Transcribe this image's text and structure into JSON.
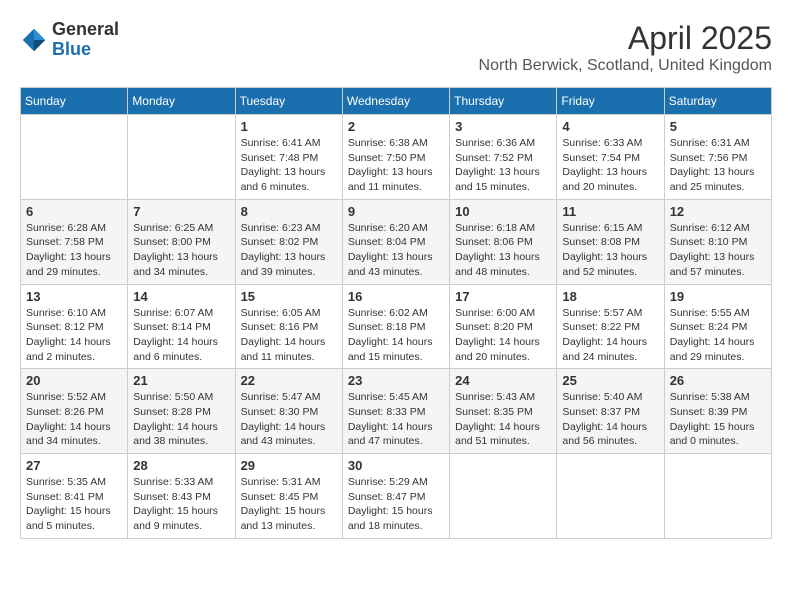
{
  "logo": {
    "general": "General",
    "blue": "Blue"
  },
  "title": "April 2025",
  "location": "North Berwick, Scotland, United Kingdom",
  "weekdays": [
    "Sunday",
    "Monday",
    "Tuesday",
    "Wednesday",
    "Thursday",
    "Friday",
    "Saturday"
  ],
  "weeks": [
    [
      {
        "day": "",
        "info": ""
      },
      {
        "day": "",
        "info": ""
      },
      {
        "day": "1",
        "info": "Sunrise: 6:41 AM\nSunset: 7:48 PM\nDaylight: 13 hours and 6 minutes."
      },
      {
        "day": "2",
        "info": "Sunrise: 6:38 AM\nSunset: 7:50 PM\nDaylight: 13 hours and 11 minutes."
      },
      {
        "day": "3",
        "info": "Sunrise: 6:36 AM\nSunset: 7:52 PM\nDaylight: 13 hours and 15 minutes."
      },
      {
        "day": "4",
        "info": "Sunrise: 6:33 AM\nSunset: 7:54 PM\nDaylight: 13 hours and 20 minutes."
      },
      {
        "day": "5",
        "info": "Sunrise: 6:31 AM\nSunset: 7:56 PM\nDaylight: 13 hours and 25 minutes."
      }
    ],
    [
      {
        "day": "6",
        "info": "Sunrise: 6:28 AM\nSunset: 7:58 PM\nDaylight: 13 hours and 29 minutes."
      },
      {
        "day": "7",
        "info": "Sunrise: 6:25 AM\nSunset: 8:00 PM\nDaylight: 13 hours and 34 minutes."
      },
      {
        "day": "8",
        "info": "Sunrise: 6:23 AM\nSunset: 8:02 PM\nDaylight: 13 hours and 39 minutes."
      },
      {
        "day": "9",
        "info": "Sunrise: 6:20 AM\nSunset: 8:04 PM\nDaylight: 13 hours and 43 minutes."
      },
      {
        "day": "10",
        "info": "Sunrise: 6:18 AM\nSunset: 8:06 PM\nDaylight: 13 hours and 48 minutes."
      },
      {
        "day": "11",
        "info": "Sunrise: 6:15 AM\nSunset: 8:08 PM\nDaylight: 13 hours and 52 minutes."
      },
      {
        "day": "12",
        "info": "Sunrise: 6:12 AM\nSunset: 8:10 PM\nDaylight: 13 hours and 57 minutes."
      }
    ],
    [
      {
        "day": "13",
        "info": "Sunrise: 6:10 AM\nSunset: 8:12 PM\nDaylight: 14 hours and 2 minutes."
      },
      {
        "day": "14",
        "info": "Sunrise: 6:07 AM\nSunset: 8:14 PM\nDaylight: 14 hours and 6 minutes."
      },
      {
        "day": "15",
        "info": "Sunrise: 6:05 AM\nSunset: 8:16 PM\nDaylight: 14 hours and 11 minutes."
      },
      {
        "day": "16",
        "info": "Sunrise: 6:02 AM\nSunset: 8:18 PM\nDaylight: 14 hours and 15 minutes."
      },
      {
        "day": "17",
        "info": "Sunrise: 6:00 AM\nSunset: 8:20 PM\nDaylight: 14 hours and 20 minutes."
      },
      {
        "day": "18",
        "info": "Sunrise: 5:57 AM\nSunset: 8:22 PM\nDaylight: 14 hours and 24 minutes."
      },
      {
        "day": "19",
        "info": "Sunrise: 5:55 AM\nSunset: 8:24 PM\nDaylight: 14 hours and 29 minutes."
      }
    ],
    [
      {
        "day": "20",
        "info": "Sunrise: 5:52 AM\nSunset: 8:26 PM\nDaylight: 14 hours and 34 minutes."
      },
      {
        "day": "21",
        "info": "Sunrise: 5:50 AM\nSunset: 8:28 PM\nDaylight: 14 hours and 38 minutes."
      },
      {
        "day": "22",
        "info": "Sunrise: 5:47 AM\nSunset: 8:30 PM\nDaylight: 14 hours and 43 minutes."
      },
      {
        "day": "23",
        "info": "Sunrise: 5:45 AM\nSunset: 8:33 PM\nDaylight: 14 hours and 47 minutes."
      },
      {
        "day": "24",
        "info": "Sunrise: 5:43 AM\nSunset: 8:35 PM\nDaylight: 14 hours and 51 minutes."
      },
      {
        "day": "25",
        "info": "Sunrise: 5:40 AM\nSunset: 8:37 PM\nDaylight: 14 hours and 56 minutes."
      },
      {
        "day": "26",
        "info": "Sunrise: 5:38 AM\nSunset: 8:39 PM\nDaylight: 15 hours and 0 minutes."
      }
    ],
    [
      {
        "day": "27",
        "info": "Sunrise: 5:35 AM\nSunset: 8:41 PM\nDaylight: 15 hours and 5 minutes."
      },
      {
        "day": "28",
        "info": "Sunrise: 5:33 AM\nSunset: 8:43 PM\nDaylight: 15 hours and 9 minutes."
      },
      {
        "day": "29",
        "info": "Sunrise: 5:31 AM\nSunset: 8:45 PM\nDaylight: 15 hours and 13 minutes."
      },
      {
        "day": "30",
        "info": "Sunrise: 5:29 AM\nSunset: 8:47 PM\nDaylight: 15 hours and 18 minutes."
      },
      {
        "day": "",
        "info": ""
      },
      {
        "day": "",
        "info": ""
      },
      {
        "day": "",
        "info": ""
      }
    ]
  ]
}
